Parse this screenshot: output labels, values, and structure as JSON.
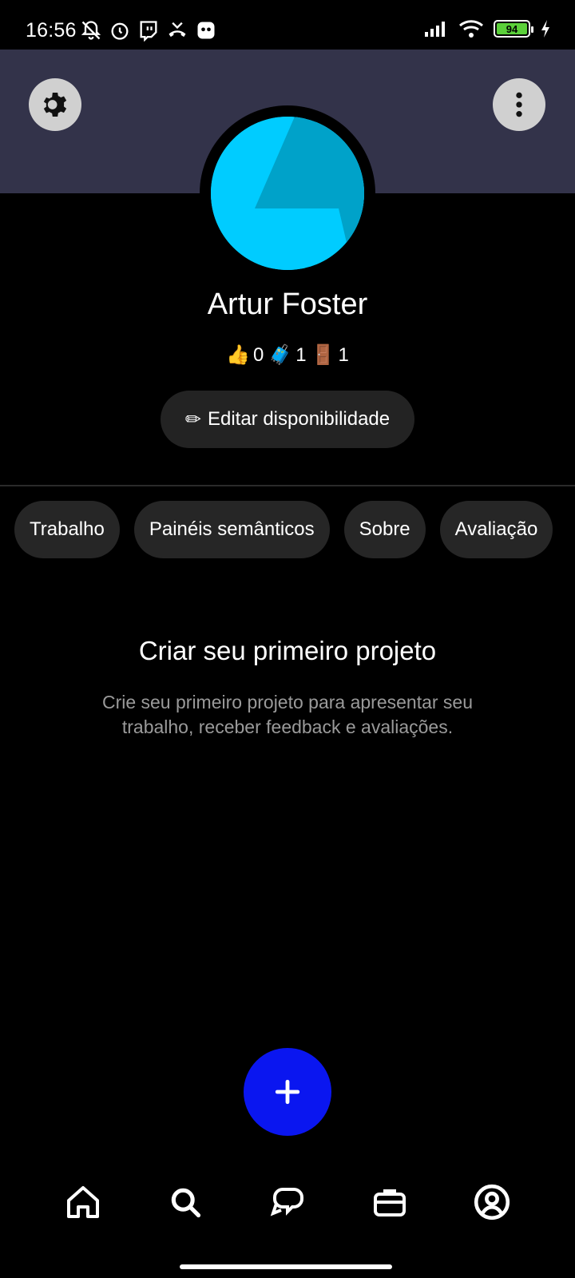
{
  "status_bar": {
    "time": "16:56",
    "battery_level": "94",
    "icons": [
      "bell-off-icon",
      "alarm-icon",
      "twitch-icon",
      "missed-call-icon",
      "app-notification-icon",
      "signal-icon",
      "wifi-icon",
      "battery-icon",
      "charging-icon"
    ]
  },
  "header": {
    "settings_icon": "gear-icon",
    "more_icon": "more-vertical-icon",
    "band_color": "#33334a"
  },
  "profile": {
    "name": "Artur Foster",
    "avatar_color": "#00ccff",
    "stats": [
      {
        "icon": "👍",
        "value": "0"
      },
      {
        "icon": "🧳",
        "value": "1"
      },
      {
        "icon": "🚪",
        "value": "1"
      }
    ],
    "edit_button": {
      "icon": "✏",
      "label": "Editar disponibilidade"
    }
  },
  "tabs": [
    {
      "label": "Trabalho"
    },
    {
      "label": "Painéis semânticos"
    },
    {
      "label": "Sobre"
    },
    {
      "label": "Avaliação"
    }
  ],
  "empty_state": {
    "title": "Criar seu primeiro projeto",
    "description": "Crie seu primeiro projeto para apresentar seu trabalho, receber feedback e avaliações."
  },
  "fab": {
    "icon": "plus-icon",
    "label": "+",
    "color": "#0a16f0"
  },
  "bottom_nav": [
    {
      "icon": "home-icon"
    },
    {
      "icon": "search-icon"
    },
    {
      "icon": "chat-icon"
    },
    {
      "icon": "briefcase-icon"
    },
    {
      "icon": "profile-icon"
    }
  ]
}
